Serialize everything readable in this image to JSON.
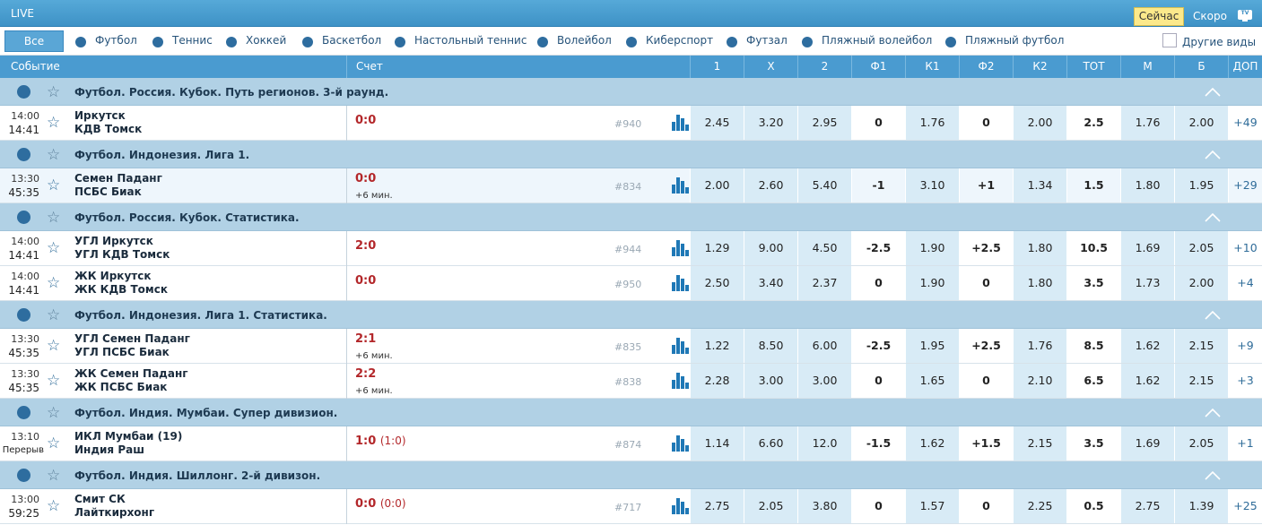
{
  "top": {
    "live": "LIVE",
    "now": "Сейчас",
    "soon": "Скоро",
    "tv": "TV"
  },
  "sports": {
    "all": "Все",
    "items": [
      {
        "label": "Футбол",
        "icon": "football-icon"
      },
      {
        "label": "Теннис",
        "icon": "tennis-icon"
      },
      {
        "label": "Хоккей",
        "icon": "hockey-icon"
      },
      {
        "label": "Баскетбол",
        "icon": "basketball-icon"
      },
      {
        "label": "Настольный теннис",
        "icon": "table-tennis-icon"
      },
      {
        "label": "Волейбол",
        "icon": "volleyball-icon"
      },
      {
        "label": "Киберспорт",
        "icon": "gamepad-icon"
      },
      {
        "label": "Футзал",
        "icon": "futsal-icon"
      },
      {
        "label": "Пляжный волейбол",
        "icon": "beach-volleyball-icon"
      },
      {
        "label": "Пляжный футбол",
        "icon": "beach-football-icon"
      }
    ],
    "other": "Другие виды"
  },
  "columns": {
    "event": "Событие",
    "score": "Счет",
    "odds": [
      "1",
      "X",
      "2",
      "Ф1",
      "К1",
      "Ф2",
      "К2",
      "ТОТ",
      "М",
      "Б",
      "ДОП"
    ]
  },
  "groups": [
    {
      "title": "Футбол. Россия. Кубок. Путь регионов. 3-й раунд.",
      "events": [
        {
          "start": "14:00",
          "clock": "14:41",
          "home": "Иркутск",
          "away": "КДВ Томск",
          "score": "0:0",
          "half": "",
          "extra": "",
          "id": "#940",
          "odds": [
            "2.45",
            "3.20",
            "2.95",
            "0",
            "1.76",
            "0",
            "2.00",
            "2.5",
            "1.76",
            "2.00",
            "+49"
          ]
        }
      ]
    },
    {
      "title": "Футбол. Индонезия. Лига 1.",
      "events": [
        {
          "start": "13:30",
          "clock": "45:35",
          "home": "Семен Паданг",
          "away": "ПСБС Биак",
          "score": "0:0",
          "half": "",
          "extra": "+6 мин.",
          "id": "#834",
          "odds": [
            "2.00",
            "2.60",
            "5.40",
            "-1",
            "3.10",
            "+1",
            "1.34",
            "1.5",
            "1.80",
            "1.95",
            "+29"
          ]
        }
      ]
    },
    {
      "title": "Футбол. Россия. Кубок. Статистика.",
      "events": [
        {
          "start": "14:00",
          "clock": "14:41",
          "home": "УГЛ Иркутск",
          "away": "УГЛ КДВ Томск",
          "score": "2:0",
          "half": "",
          "extra": "",
          "id": "#944",
          "odds": [
            "1.29",
            "9.00",
            "4.50",
            "-2.5",
            "1.90",
            "+2.5",
            "1.80",
            "10.5",
            "1.69",
            "2.05",
            "+10"
          ]
        },
        {
          "start": "14:00",
          "clock": "14:41",
          "home": "ЖК Иркутск",
          "away": "ЖК КДВ Томск",
          "score": "0:0",
          "half": "",
          "extra": "",
          "id": "#950",
          "odds": [
            "2.50",
            "3.40",
            "2.37",
            "0",
            "1.90",
            "0",
            "1.80",
            "3.5",
            "1.73",
            "2.00",
            "+4"
          ]
        }
      ]
    },
    {
      "title": "Футбол. Индонезия. Лига 1. Статистика.",
      "events": [
        {
          "start": "13:30",
          "clock": "45:35",
          "home": "УГЛ Семен Паданг",
          "away": "УГЛ ПСБС Биак",
          "score": "2:1",
          "half": "",
          "extra": "+6 мин.",
          "id": "#835",
          "odds": [
            "1.22",
            "8.50",
            "6.00",
            "-2.5",
            "1.95",
            "+2.5",
            "1.76",
            "8.5",
            "1.62",
            "2.15",
            "+9"
          ]
        },
        {
          "start": "13:30",
          "clock": "45:35",
          "home": "ЖК Семен Паданг",
          "away": "ЖК ПСБС Биак",
          "score": "2:2",
          "half": "",
          "extra": "+6 мин.",
          "id": "#838",
          "odds": [
            "2.28",
            "3.00",
            "3.00",
            "0",
            "1.65",
            "0",
            "2.10",
            "6.5",
            "1.62",
            "2.15",
            "+3"
          ]
        }
      ]
    },
    {
      "title": "Футбол. Индия. Мумбаи. Супер дивизион.",
      "events": [
        {
          "start": "13:10",
          "clock": "Перерыв",
          "home": "ИКЛ Мумбаи (19)",
          "away": "Индия Раш",
          "score": "1:0",
          "half": "(1:0)",
          "extra": "",
          "id": "#874",
          "odds": [
            "1.14",
            "6.60",
            "12.0",
            "-1.5",
            "1.62",
            "+1.5",
            "2.15",
            "3.5",
            "1.69",
            "2.05",
            "+1"
          ]
        }
      ]
    },
    {
      "title": "Футбол. Индия. Шиллонг. 2-й дивизон.",
      "events": [
        {
          "start": "13:00",
          "clock": "59:25",
          "home": "Смит СК",
          "away": "Лайткирхонг",
          "score": "0:0",
          "half": "(0:0)",
          "extra": "",
          "id": "#717",
          "odds": [
            "2.75",
            "2.05",
            "3.80",
            "0",
            "1.57",
            "0",
            "2.25",
            "0.5",
            "2.75",
            "1.39",
            "+25"
          ]
        }
      ]
    }
  ]
}
